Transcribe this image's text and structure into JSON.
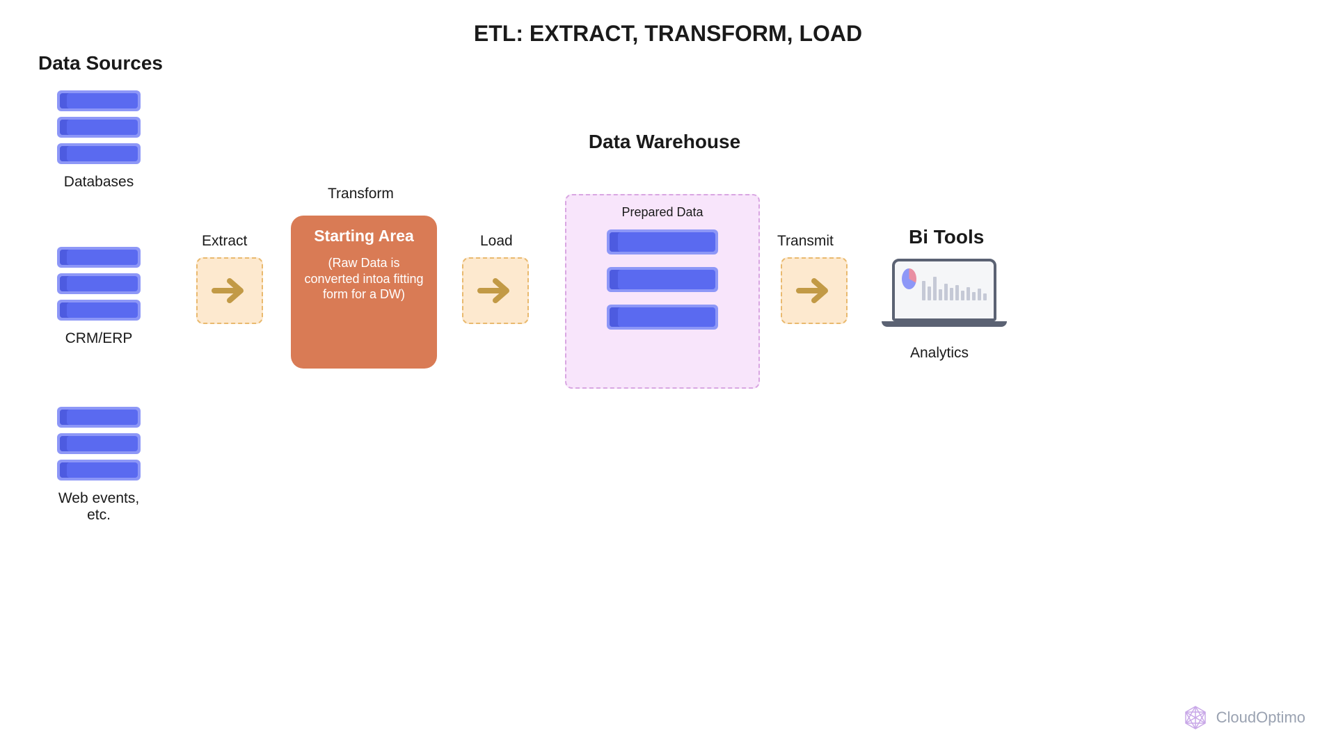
{
  "title": "ETL: EXTRACT, TRANSFORM, LOAD",
  "sources": {
    "heading": "Data Sources",
    "items": [
      "Databases",
      "CRM/ERP",
      "Web events, etc."
    ]
  },
  "arrows": {
    "extract": "Extract",
    "load": "Load",
    "transmit": "Transmit"
  },
  "transform": {
    "label": "Transform",
    "title": "Starting Area",
    "desc": "(Raw Data is converted intoa fitting form for a DW)"
  },
  "warehouse": {
    "heading": "Data Warehouse",
    "sub": "Prepared Data"
  },
  "bi": {
    "heading": "Bi Tools",
    "caption": "Analytics"
  },
  "brand": "CloudOptimo",
  "colors": {
    "arrow": "#c29a46",
    "transform_bg": "#d97b55",
    "warehouse_bg": "#f8e5fb",
    "db_dark": "#5a6af0"
  }
}
